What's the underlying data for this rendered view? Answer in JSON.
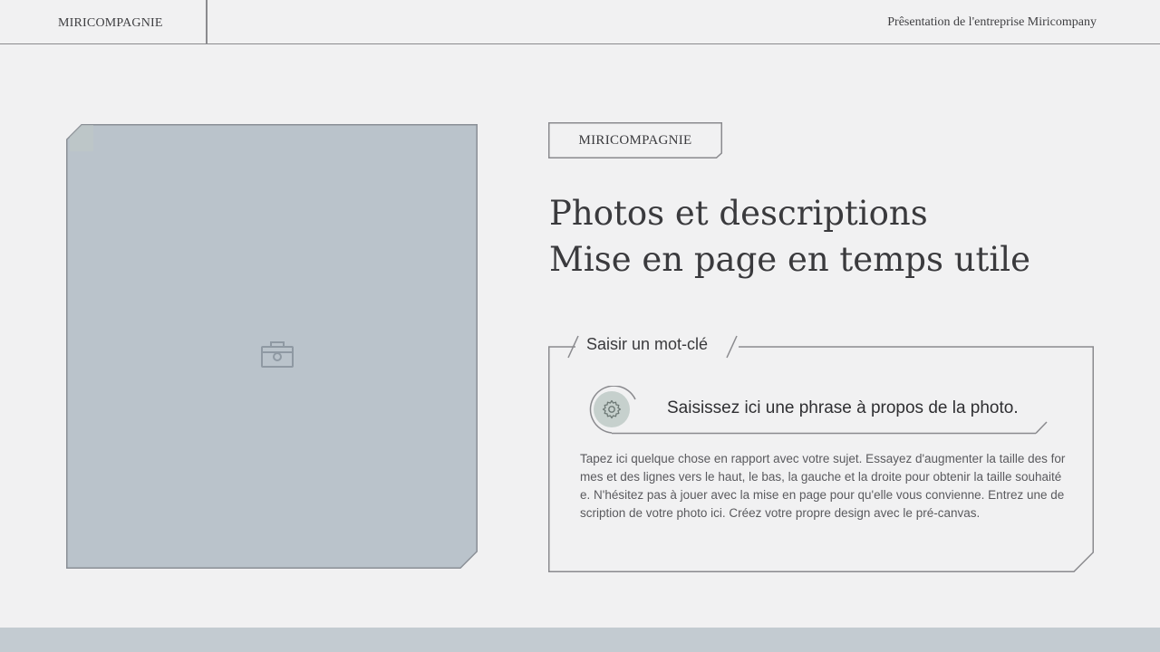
{
  "header": {
    "brand": "MIRICOMPAGNIE",
    "presentation_title": "Prêsentation de l'entreprise Miricompany"
  },
  "photo": {
    "icon": "camera-icon",
    "fill_color": "#bac3cb"
  },
  "tag": {
    "label": "MIRICOMPAGNIE"
  },
  "title": {
    "line1": "Photos et descriptions",
    "line2": "Mise en page en temps utile"
  },
  "card": {
    "keyword_label": "Saisir un mot-clé",
    "icon": "gear-icon",
    "caption": "Saisissez ici une phrase à propos de la photo.",
    "description": "Tapez ici quelque chose en rapport avec votre sujet. Essayez d'augmenter la taille des formes et des lignes vers le haut, le bas, la gauche et la droite pour obtenir la taille souhaitée. N'hésitez pas à jouer avec la mise en page pour qu'elle vous convienne. Entrez une description de votre photo ici. Créez votre propre design avec le pré-canvas."
  },
  "colors": {
    "background": "#f1f1f2",
    "line": "#8a8a8e",
    "footer_band": "#c3cbd1",
    "icon_circle": "#c6d0cd"
  }
}
